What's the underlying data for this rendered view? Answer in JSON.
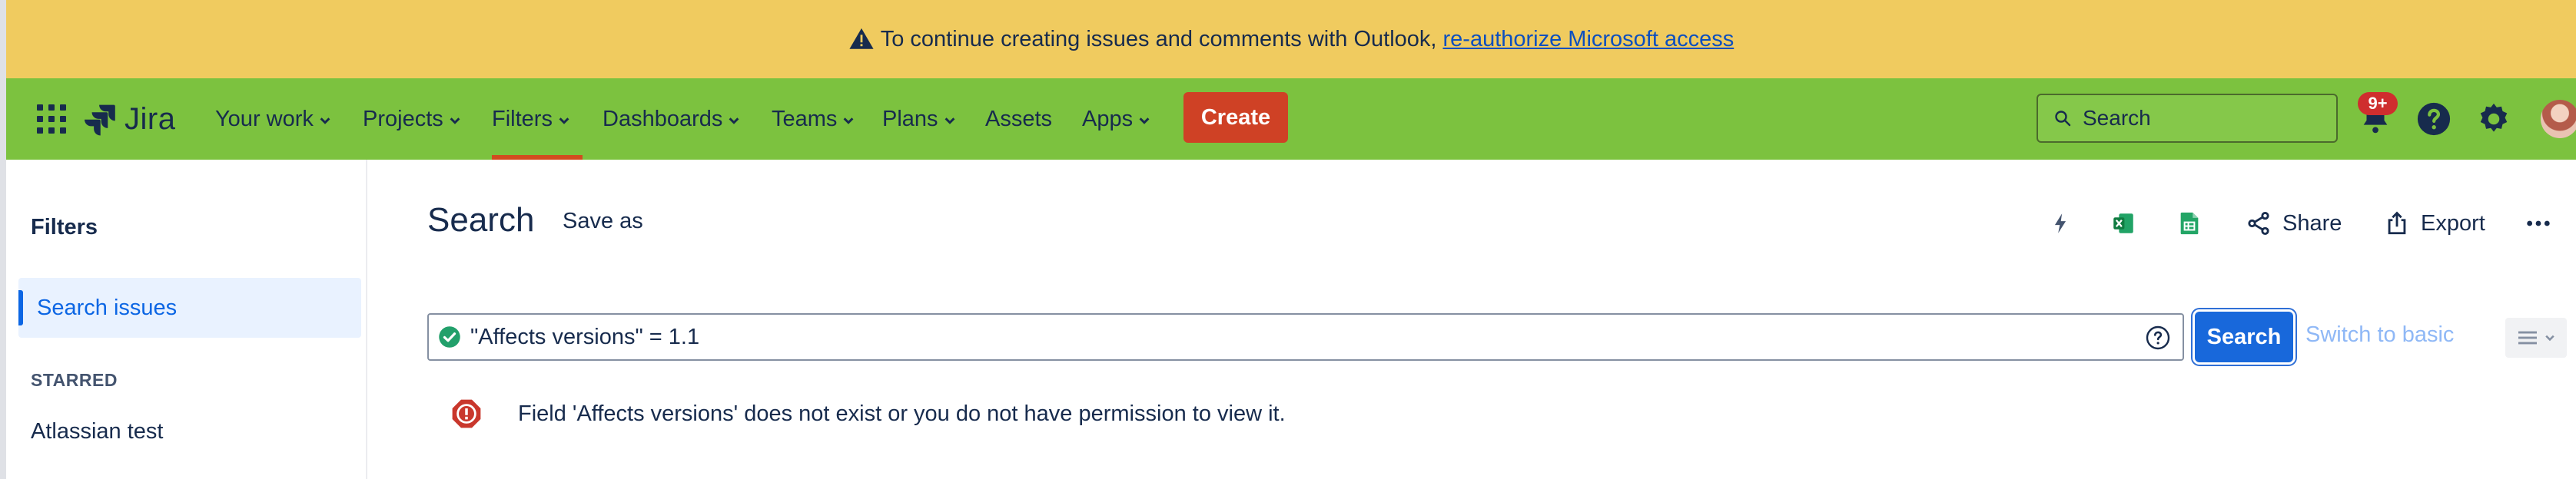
{
  "banner": {
    "message": "To continue creating issues and comments with Outlook,",
    "link": "re-authorize Microsoft access"
  },
  "nav": {
    "logo": "Jira",
    "items": [
      {
        "label": "Your work",
        "chevron": true
      },
      {
        "label": "Projects",
        "chevron": true
      },
      {
        "label": "Filters",
        "chevron": true,
        "active": true
      },
      {
        "label": "Dashboards",
        "chevron": true
      },
      {
        "label": "Teams",
        "chevron": true
      },
      {
        "label": "Plans",
        "chevron": true
      },
      {
        "label": "Assets",
        "chevron": false
      },
      {
        "label": "Apps",
        "chevron": true
      }
    ],
    "create_label": "Create",
    "search_placeholder": "Search",
    "notification_badge": "9+"
  },
  "sidebar": {
    "title": "Filters",
    "active_item": "Search issues",
    "section": "STARRED",
    "starred": [
      "Atlassian test"
    ]
  },
  "main": {
    "title": "Search",
    "save_as": "Save as",
    "share": "Share",
    "export": "Export",
    "jql_value": "\"Affects versions\" = 1.1",
    "search_button": "Search",
    "switch_basic": "Switch to basic",
    "error_message": "Field 'Affects versions' does not exist or you do not have permission to view it."
  },
  "colors": {
    "banner": "#f0cb5f",
    "nav": "#7cc23f",
    "create": "#cf4125",
    "primary": "#1868db",
    "error": "#c9372c",
    "success": "#22a06b"
  }
}
